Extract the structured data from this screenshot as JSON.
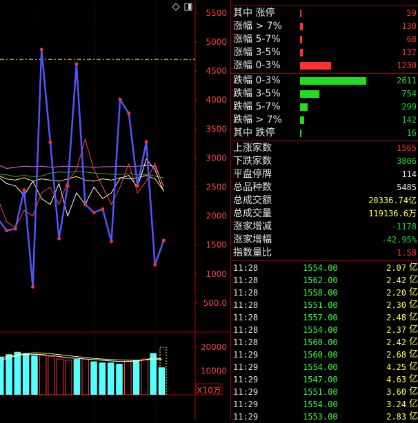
{
  "header": {
    "title_partial": ""
  },
  "toolbar": {
    "diamond_icon": "diamond-icon",
    "window_icon": "window-icon"
  },
  "colors": {
    "up": "#ff3030",
    "down": "#20dd20",
    "grid": "#b00000",
    "yellow": "#ffff55"
  },
  "chart_data": [
    {
      "type": "line",
      "title": "",
      "yticks": [
        "5500",
        "5000",
        "4500",
        "4000",
        "3500",
        "3000",
        "2500",
        "2000",
        "1500",
        "1000",
        "500.0"
      ],
      "ylim": [
        0,
        5700
      ],
      "reference_line": 4700,
      "series": [
        {
          "values": [
            1950,
            1750,
            1780,
            2450,
            780,
            4870,
            3270,
            1610,
            2520,
            4620,
            2200,
            2060,
            2120,
            1560,
            4010,
            3770,
            2520,
            3280,
            1160,
            1580
          ]
        },
        {
          "values": [
            2720,
            2710,
            2680,
            2700,
            2680,
            2690,
            2740,
            2760,
            2750,
            2770,
            2760,
            2740,
            2730,
            2720,
            2720,
            2730,
            2710,
            2720,
            2690,
            2660
          ]
        },
        {
          "values": [
            2880,
            2820,
            2840,
            2860,
            2850,
            2860,
            2840,
            2850,
            2860,
            2850,
            2850,
            2840,
            2850,
            2850,
            2860,
            2850,
            2860,
            2870,
            2860,
            2520
          ]
        },
        {
          "values": [
            2700,
            2640,
            2620,
            2660,
            2600,
            2640,
            2620,
            2600,
            2640,
            2680,
            2620,
            2600,
            2640,
            2620,
            2660,
            2640,
            2660,
            2700,
            2640,
            2440
          ]
        },
        {
          "values": [
            2680,
            2560,
            2520,
            2360,
            2600,
            2300,
            2200,
            2560,
            2000,
            2400,
            2200,
            2500,
            2300,
            2400,
            2650,
            2700,
            2500,
            2980,
            2800,
            2420
          ]
        },
        {
          "values": [
            2300,
            1900,
            1800,
            2100,
            2000,
            2400,
            2500,
            2200,
            2600,
            2800,
            3320,
            2800,
            2500,
            2200,
            2500,
            2900,
            2400,
            2600,
            2900,
            2500
          ]
        }
      ]
    },
    {
      "type": "bar",
      "ylabel_unit": "X10万",
      "yticks": [
        "20000",
        "10000"
      ],
      "ylim": [
        0,
        24000
      ],
      "values": [
        16000,
        17000,
        18000,
        17500,
        16500,
        16500,
        16000,
        15000,
        14500,
        15000,
        15000,
        14000,
        13500,
        13500,
        13000,
        14000,
        14500,
        15000,
        17500,
        11500
      ],
      "hollow": [
        false,
        false,
        false,
        false,
        false,
        true,
        true,
        true,
        true,
        false,
        true,
        false,
        false,
        false,
        false,
        true,
        false,
        true,
        false,
        false
      ]
    }
  ],
  "stats": {
    "up_section": [
      {
        "label": "其中 涨停",
        "value": "59",
        "bar": 0.02
      },
      {
        "label": "涨幅 > 7%",
        "value": "130",
        "bar": 0.04
      },
      {
        "label": "涨幅 5-7%",
        "value": "68",
        "bar": 0.03
      },
      {
        "label": "涨幅 3-5%",
        "value": "137",
        "bar": 0.04
      },
      {
        "label": "涨幅 0-3%",
        "value": "1230",
        "bar": 0.47
      }
    ],
    "down_section": [
      {
        "label": "跌幅 0-3%",
        "value": "2611",
        "bar": 1.0
      },
      {
        "label": "跌幅 3-5%",
        "value": "754",
        "bar": 0.29
      },
      {
        "label": "跌幅 5-7%",
        "value": "299",
        "bar": 0.11
      },
      {
        "label": "跌幅 > 7%",
        "value": "142",
        "bar": 0.06
      },
      {
        "label": "其中 跌停",
        "value": "16",
        "bar": 0.01
      }
    ],
    "summary": [
      {
        "label": "上涨家数",
        "value": "1565",
        "color": "#ff3030"
      },
      {
        "label": "下跌家数",
        "value": "3806",
        "color": "#20dd20"
      },
      {
        "label": "平盘停牌",
        "value": "114",
        "color": "#e6e6e6"
      },
      {
        "label": "总品种数",
        "value": "5485",
        "color": "#e6e6e6"
      },
      {
        "label": "总成交额",
        "value": "20336.74亿",
        "color": "#ffff55"
      },
      {
        "label": "总成交量",
        "value": "119136.6万",
        "color": "#ffff55"
      },
      {
        "label": "涨家增减",
        "value": "-1178",
        "color": "#20dd20"
      },
      {
        "label": "涨家增幅",
        "value": "-42.95%",
        "color": "#20dd20"
      },
      {
        "label": "指数量比",
        "value": "1.58",
        "color": "#ff3030"
      }
    ]
  },
  "ticks": [
    {
      "time": "11:28",
      "price": "1554.00",
      "amount": "2.07",
      "unit": "亿"
    },
    {
      "time": "11:28",
      "price": "1562.00",
      "amount": "2.42",
      "unit": "亿"
    },
    {
      "time": "11:28",
      "price": "1558.00",
      "amount": "2.20",
      "unit": "亿"
    },
    {
      "time": "11:28",
      "price": "1551.00",
      "amount": "2.30",
      "unit": "亿"
    },
    {
      "time": "11:28",
      "price": "1557.00",
      "amount": "2.48",
      "unit": "亿"
    },
    {
      "time": "11:28",
      "price": "1554.00",
      "amount": "2.37",
      "unit": "亿"
    },
    {
      "time": "11:28",
      "price": "1560.00",
      "amount": "2.42",
      "unit": "亿"
    },
    {
      "time": "11:29",
      "price": "1560.00",
      "amount": "2.68",
      "unit": "亿"
    },
    {
      "time": "11:29",
      "price": "1554.00",
      "amount": "4.25",
      "unit": "亿"
    },
    {
      "time": "11:29",
      "price": "1547.00",
      "amount": "4.63",
      "unit": "亿"
    },
    {
      "time": "11:29",
      "price": "1551.00",
      "amount": "3.60",
      "unit": "亿"
    },
    {
      "time": "11:29",
      "price": "1554.00",
      "amount": "3.24",
      "unit": "亿"
    },
    {
      "time": "11:29",
      "price": "1553.00",
      "amount": "2.83",
      "unit": "亿"
    }
  ]
}
